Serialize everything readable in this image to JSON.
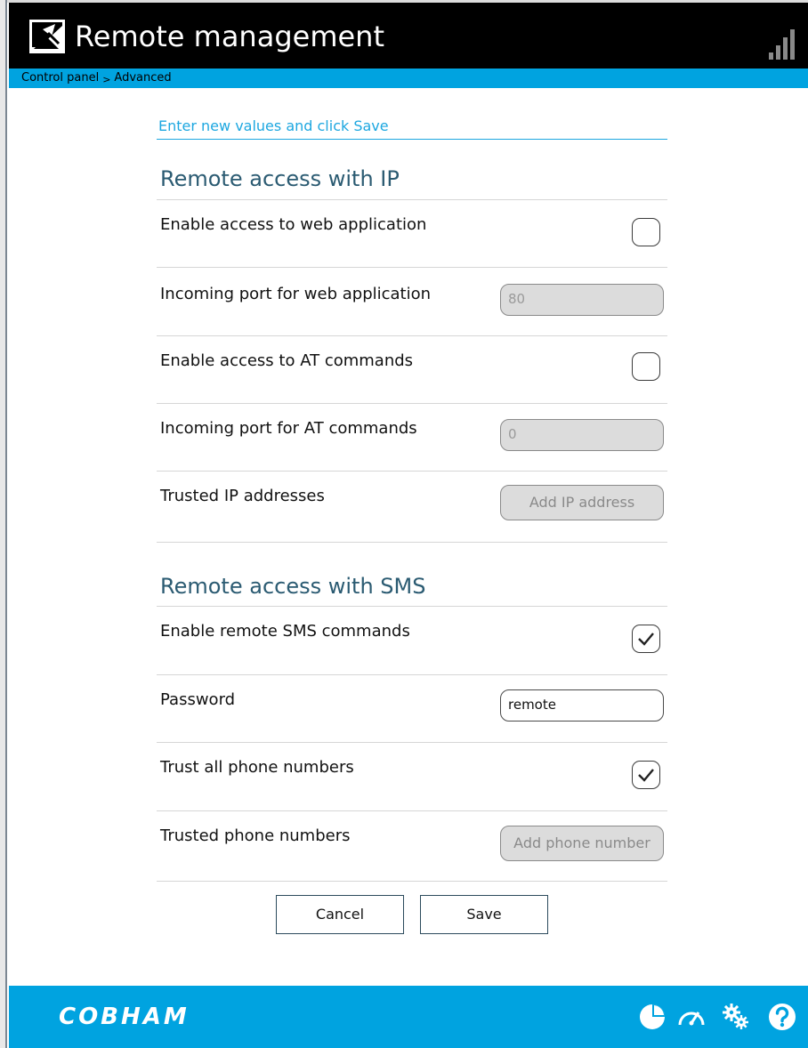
{
  "header": {
    "title": "Remote management",
    "logo_icon": "satellite-dish-icon",
    "signal_icon": "signal-strength-icon"
  },
  "breadcrumb": {
    "items": [
      "Control panel",
      "Advanced"
    ],
    "separator": ">"
  },
  "form": {
    "intro": "Enter new values and click Save",
    "sections": {
      "ip": {
        "title": "Remote access with IP",
        "enable_web_label": "Enable access to web application",
        "enable_web_checked": false,
        "web_port_label": "Incoming port for web application",
        "web_port_value": "80",
        "enable_at_label": "Enable access to AT commands",
        "enable_at_checked": false,
        "at_port_label": "Incoming port for AT commands",
        "at_port_value": "0",
        "trusted_ip_label": "Trusted IP addresses",
        "add_ip_button": "Add IP address"
      },
      "sms": {
        "title": "Remote access with SMS",
        "enable_sms_label": "Enable remote SMS commands",
        "enable_sms_checked": true,
        "password_label": "Password",
        "password_value": "remote",
        "trust_all_label": "Trust all phone numbers",
        "trust_all_checked": true,
        "trusted_phone_label": "Trusted phone numbers",
        "add_phone_button": "Add phone number"
      }
    },
    "buttons": {
      "cancel": "Cancel",
      "save": "Save"
    }
  },
  "footer": {
    "brand": "COBHAM",
    "icons": [
      "pie-chart-icon",
      "speedometer-icon",
      "settings-gears-icon",
      "help-icon"
    ]
  },
  "colors": {
    "accent": "#00a3e0",
    "header_bg": "#000000",
    "section_title": "#2b5b72"
  }
}
